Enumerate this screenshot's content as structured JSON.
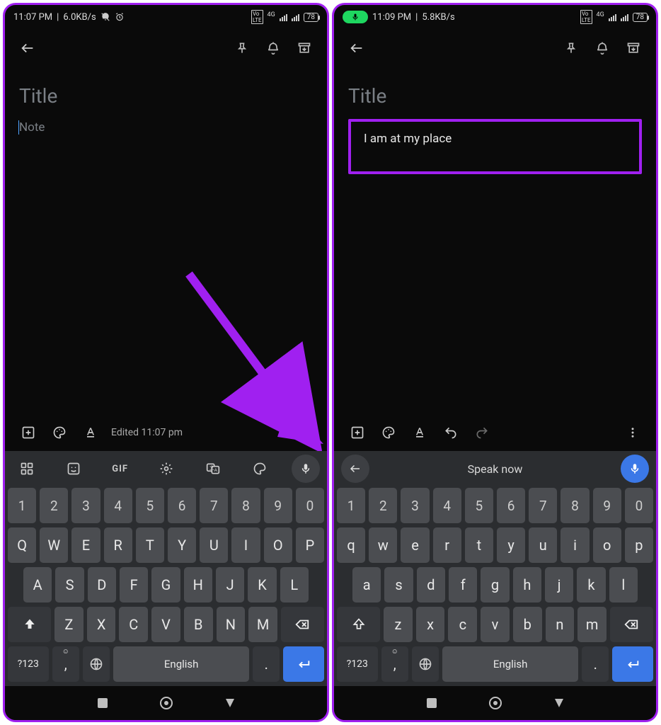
{
  "left": {
    "status": {
      "time": "11:07 PM",
      "net": "6.0KB/s",
      "battery": "78",
      "carrier": "4G"
    },
    "appbar": {},
    "content": {
      "title_placeholder": "Title",
      "note_placeholder": "Note"
    },
    "notetool": {
      "edited": "Edited 11:07 pm"
    },
    "keyboard": {
      "toolbar": {
        "gif_label": "GIF"
      },
      "numrow": [
        "1",
        "2",
        "3",
        "4",
        "5",
        "6",
        "7",
        "8",
        "9",
        "0"
      ],
      "row1": [
        "Q",
        "W",
        "E",
        "R",
        "T",
        "Y",
        "U",
        "I",
        "O",
        "P"
      ],
      "row2": [
        "A",
        "S",
        "D",
        "F",
        "G",
        "H",
        "J",
        "K",
        "L"
      ],
      "row3": [
        "Z",
        "X",
        "C",
        "V",
        "B",
        "N",
        "M"
      ],
      "bottom": {
        "symnum": "?123",
        "comma": ",",
        "space": "English",
        "period": "."
      }
    }
  },
  "right": {
    "status": {
      "time": "11:09 PM",
      "net": "5.8KB/s",
      "battery": "78",
      "carrier": "4G"
    },
    "content": {
      "title_placeholder": "Title",
      "note_text": "I am at my place"
    },
    "keyboard": {
      "toolbar": {
        "speak_label": "Speak now"
      },
      "numrow": [
        "1",
        "2",
        "3",
        "4",
        "5",
        "6",
        "7",
        "8",
        "9",
        "0"
      ],
      "row1": [
        "q",
        "w",
        "e",
        "r",
        "t",
        "y",
        "u",
        "i",
        "o",
        "p"
      ],
      "row2": [
        "a",
        "s",
        "d",
        "f",
        "g",
        "h",
        "j",
        "k",
        "l"
      ],
      "row3": [
        "z",
        "x",
        "c",
        "v",
        "b",
        "n",
        "m"
      ],
      "bottom": {
        "symnum": "?123",
        "comma": ",",
        "space": "English",
        "period": "."
      }
    }
  }
}
